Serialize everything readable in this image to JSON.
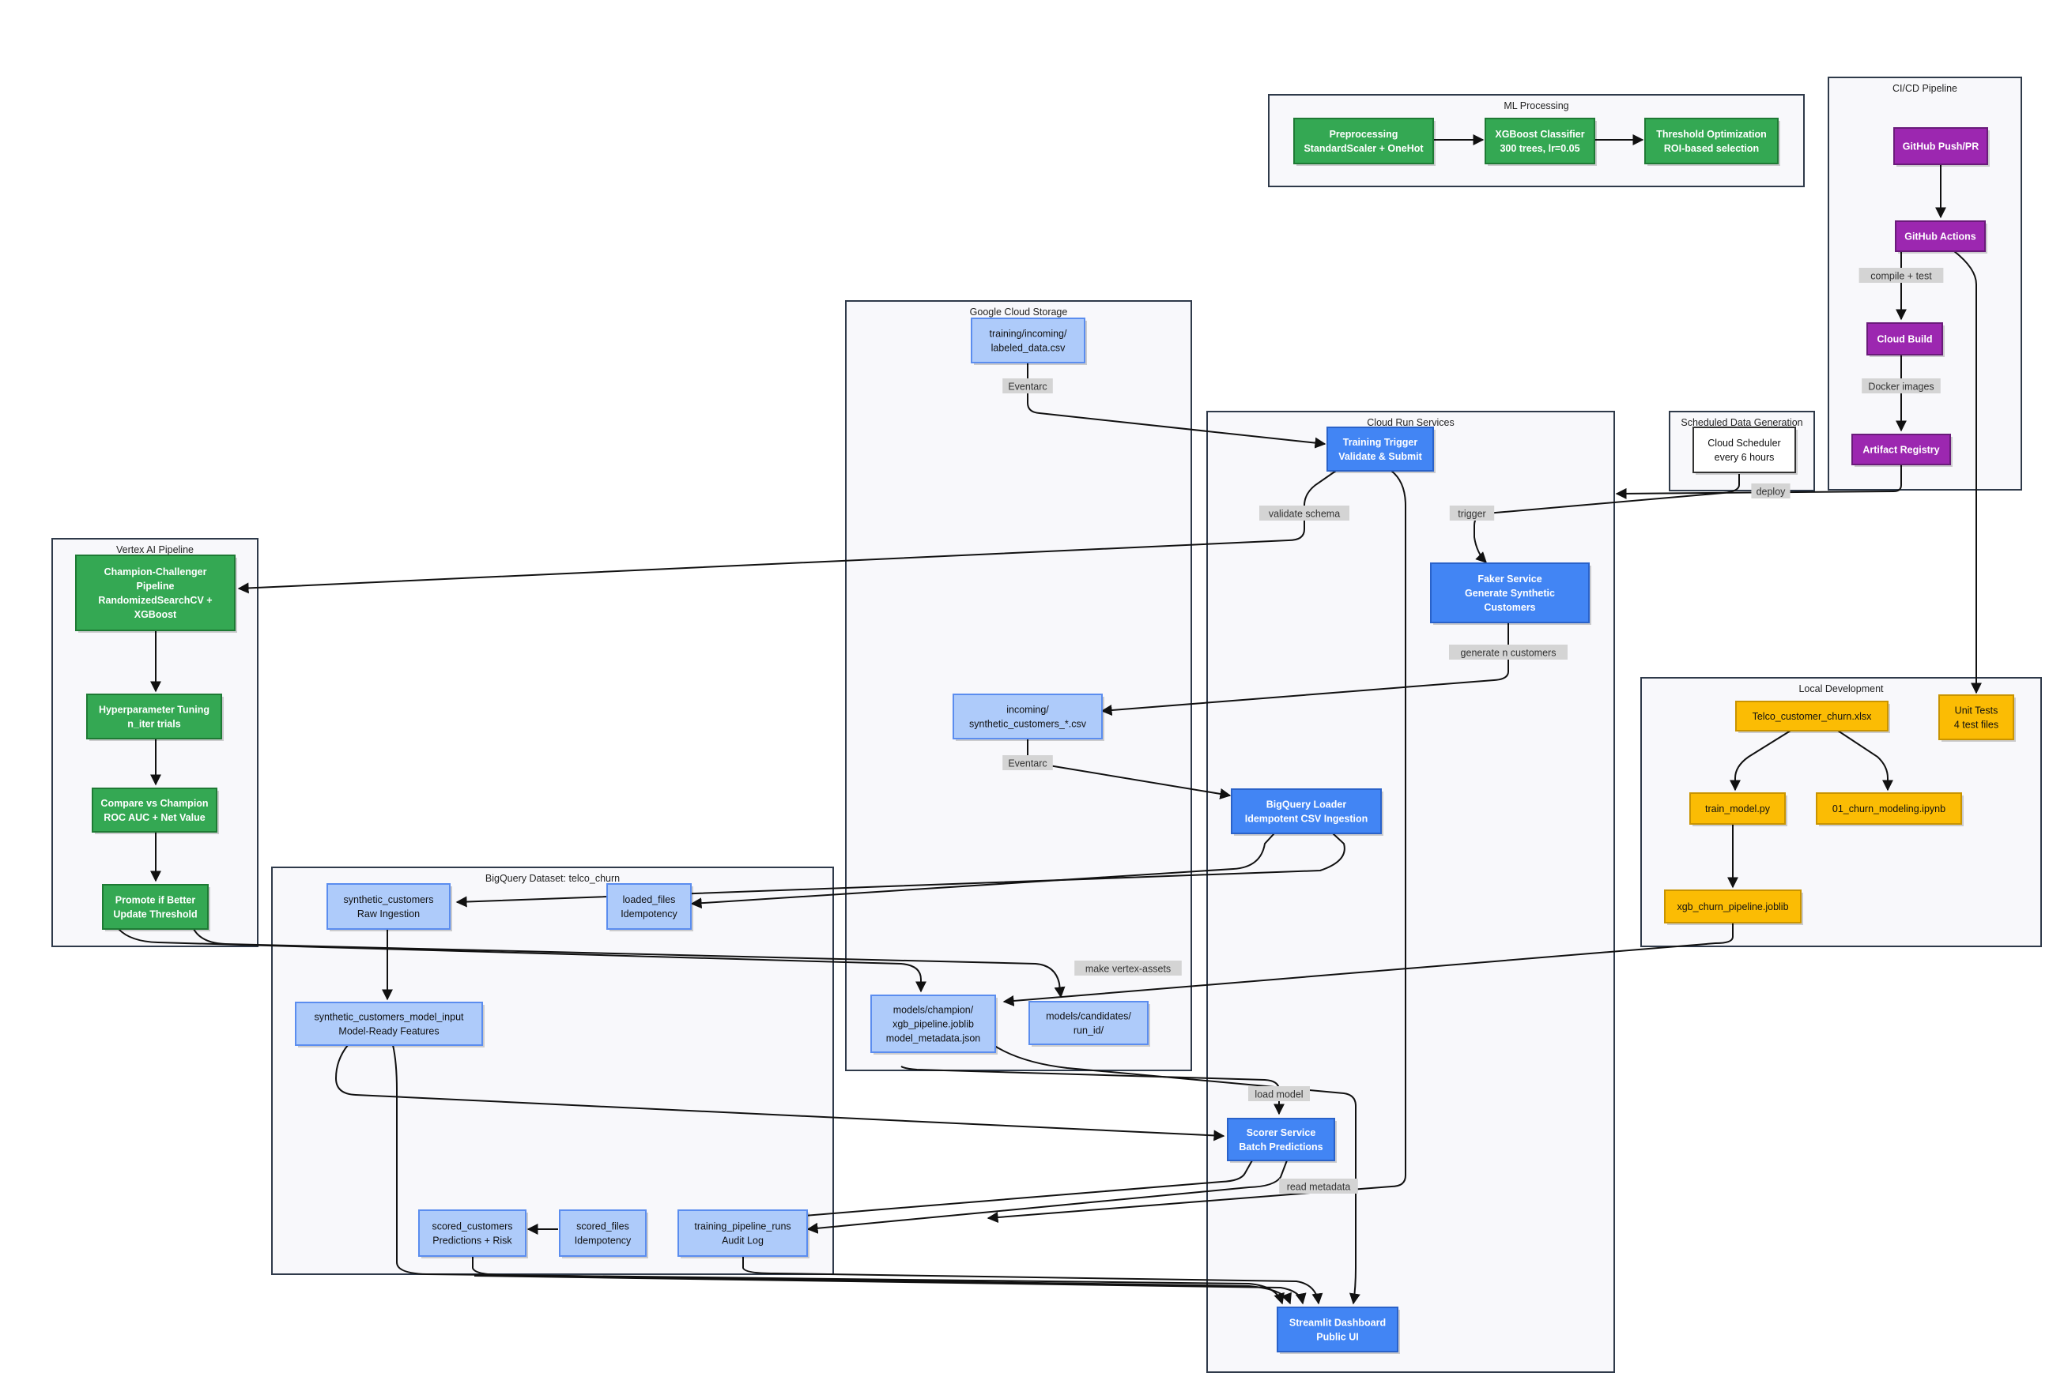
{
  "colors": {
    "green": "#34a853",
    "green_border": "#1e7a34",
    "blue": "#4285f4",
    "blue_border": "#2a62c9",
    "light_blue": "#aecbfa",
    "light_blue_border": "#5b8def",
    "purple": "#9c27b0",
    "purple_border": "#6a1b7a",
    "yellow": "#fbbc04",
    "yellow_border": "#c99400",
    "white": "#ffffff",
    "white_border": "#333333"
  },
  "clusters": [
    {
      "id": "ml",
      "title": "ML Processing"
    },
    {
      "id": "cicd",
      "title": "CI/CD Pipeline"
    },
    {
      "id": "gcs",
      "title": "Google Cloud Storage"
    },
    {
      "id": "cloudrun",
      "title": "Cloud Run Services"
    },
    {
      "id": "sched",
      "title": "Scheduled Data Generation"
    },
    {
      "id": "vertex",
      "title": "Vertex AI Pipeline"
    },
    {
      "id": "local",
      "title": "Local Development"
    },
    {
      "id": "bq",
      "title": "BigQuery Dataset: telco_churn"
    }
  ],
  "nodes": [
    {
      "id": "prep",
      "style": "green",
      "lines": [
        "Preprocessing",
        "StandardScaler + OneHot"
      ]
    },
    {
      "id": "xgb",
      "style": "green",
      "lines": [
        "XGBoost Classifier",
        "300 trees, lr=0.05"
      ]
    },
    {
      "id": "thresh",
      "style": "green",
      "lines": [
        "Threshold Optimization",
        "ROI-based selection"
      ]
    },
    {
      "id": "ghpush",
      "style": "purple",
      "lines": [
        "GitHub Push/PR"
      ]
    },
    {
      "id": "ghact",
      "style": "purple",
      "lines": [
        "GitHub Actions"
      ]
    },
    {
      "id": "cbuild",
      "style": "purple",
      "lines": [
        "Cloud Build"
      ]
    },
    {
      "id": "areg",
      "style": "purple",
      "lines": [
        "Artifact Registry"
      ]
    },
    {
      "id": "labeled",
      "style": "light_blue",
      "lines": [
        "training/incoming/",
        "labeled_data.csv"
      ]
    },
    {
      "id": "synthcsv",
      "style": "light_blue",
      "lines": [
        "incoming/",
        "synthetic_customers_*.csv"
      ]
    },
    {
      "id": "champ",
      "style": "light_blue",
      "lines": [
        "models/champion/",
        "xgb_pipeline.joblib",
        "model_metadata.json"
      ]
    },
    {
      "id": "cands",
      "style": "light_blue",
      "lines": [
        "models/candidates/",
        "run_id/"
      ]
    },
    {
      "id": "trig",
      "style": "blue",
      "lines": [
        "Training Trigger",
        "Validate & Submit"
      ]
    },
    {
      "id": "faker",
      "style": "blue",
      "lines": [
        "Faker Service",
        "Generate Synthetic",
        "Customers"
      ]
    },
    {
      "id": "bqload",
      "style": "blue",
      "lines": [
        "BigQuery Loader",
        "Idempotent CSV Ingestion"
      ]
    },
    {
      "id": "scorer",
      "style": "blue",
      "lines": [
        "Scorer Service",
        "Batch Predictions"
      ]
    },
    {
      "id": "dash",
      "style": "blue",
      "lines": [
        "Streamlit Dashboard",
        "Public UI"
      ]
    },
    {
      "id": "cron",
      "style": "white",
      "lines": [
        "Cloud Scheduler",
        "every 6 hours"
      ]
    },
    {
      "id": "ccp",
      "style": "green",
      "lines": [
        "Champion-Challenger",
        "Pipeline",
        "RandomizedSearchCV +",
        "XGBoost"
      ]
    },
    {
      "id": "hpt",
      "style": "green",
      "lines": [
        "Hyperparameter Tuning",
        "n_iter trials"
      ]
    },
    {
      "id": "cmp",
      "style": "green",
      "lines": [
        "Compare vs Champion",
        "ROC AUC + Net Value"
      ]
    },
    {
      "id": "promote",
      "style": "green",
      "lines": [
        "Promote if Better",
        "Update Threshold"
      ]
    },
    {
      "id": "xlsx",
      "style": "yellow",
      "lines": [
        "Telco_customer_churn.xlsx"
      ]
    },
    {
      "id": "utests",
      "style": "yellow",
      "lines": [
        "Unit Tests",
        "4 test files"
      ]
    },
    {
      "id": "trainpy",
      "style": "yellow",
      "lines": [
        "train_model.py"
      ]
    },
    {
      "id": "nb",
      "style": "yellow",
      "lines": [
        "01_churn_modeling.ipynb"
      ]
    },
    {
      "id": "joblib",
      "style": "yellow",
      "lines": [
        "xgb_churn_pipeline.joblib"
      ]
    },
    {
      "id": "synthcust",
      "style": "light_blue",
      "lines": [
        "synthetic_customers",
        "Raw Ingestion"
      ]
    },
    {
      "id": "loaded",
      "style": "light_blue",
      "lines": [
        "loaded_files",
        "Idempotency"
      ]
    },
    {
      "id": "modelinput",
      "style": "light_blue",
      "lines": [
        "synthetic_customers_model_input",
        "Model-Ready Features"
      ]
    },
    {
      "id": "scored",
      "style": "light_blue",
      "lines": [
        "scored_customers",
        "Predictions + Risk"
      ]
    },
    {
      "id": "scoredfiles",
      "style": "light_blue",
      "lines": [
        "scored_files",
        "Idempotency"
      ]
    },
    {
      "id": "tpruns",
      "style": "light_blue",
      "lines": [
        "training_pipeline_runs",
        "Audit Log"
      ]
    }
  ],
  "edge_labels": [
    {
      "id": "compile",
      "text": "compile + test"
    },
    {
      "id": "docker",
      "text": "Docker images"
    },
    {
      "id": "deploy",
      "text": "deploy"
    },
    {
      "id": "eventarc1",
      "text": "Eventarc"
    },
    {
      "id": "validate",
      "text": "validate schema"
    },
    {
      "id": "trigger",
      "text": "trigger"
    },
    {
      "id": "gencust",
      "text": "generate n customers"
    },
    {
      "id": "eventarc2",
      "text": "Eventarc"
    },
    {
      "id": "vertexassets",
      "text": "make vertex-assets"
    },
    {
      "id": "loadmodel",
      "text": "load model"
    },
    {
      "id": "readmeta",
      "text": "read metadata"
    }
  ]
}
